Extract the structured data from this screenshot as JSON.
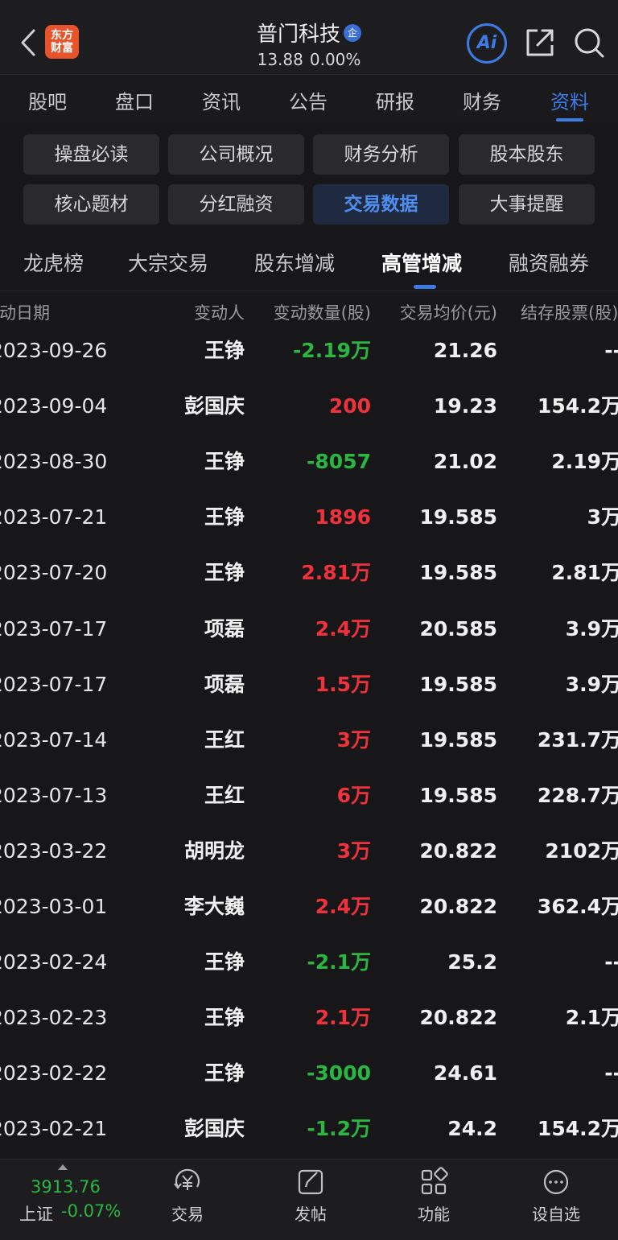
{
  "header": {
    "logo_line1": "东方",
    "logo_line2": "财富",
    "stock_name": "普门科技",
    "badge": "企",
    "price": "13.88",
    "change": "0.00%",
    "ai_label": "Ai"
  },
  "main_tabs": [
    "股吧",
    "盘口",
    "资讯",
    "公告",
    "研报",
    "财务",
    "资料"
  ],
  "main_tabs_active": "资料",
  "sub_buttons": [
    "操盘必读",
    "公司概况",
    "财务分析",
    "股本股东",
    "核心题材",
    "分红融资",
    "交易数据",
    "大事提醒"
  ],
  "sub_buttons_active": "交易数据",
  "category_tabs": [
    "龙虎榜",
    "大宗交易",
    "股东增减",
    "高管增减",
    "融资融券"
  ],
  "category_tabs_active": "高管增减",
  "table": {
    "headers": [
      "变动日期",
      "变动人",
      "变动数量(股)",
      "交易均价(元)",
      "结存股票(股)"
    ],
    "rows": [
      {
        "date": "2023-09-26",
        "person": "王铮",
        "qty": "-2.19万",
        "price": "21.26",
        "hold": "--"
      },
      {
        "date": "2023-09-04",
        "person": "彭国庆",
        "qty": "200",
        "price": "19.23",
        "hold": "154.2万"
      },
      {
        "date": "2023-08-30",
        "person": "王铮",
        "qty": "-8057",
        "price": "21.02",
        "hold": "2.19万"
      },
      {
        "date": "2023-07-21",
        "person": "王铮",
        "qty": "1896",
        "price": "19.585",
        "hold": "3万"
      },
      {
        "date": "2023-07-20",
        "person": "王铮",
        "qty": "2.81万",
        "price": "19.585",
        "hold": "2.81万"
      },
      {
        "date": "2023-07-17",
        "person": "项磊",
        "qty": "2.4万",
        "price": "20.585",
        "hold": "3.9万"
      },
      {
        "date": "2023-07-17",
        "person": "项磊",
        "qty": "1.5万",
        "price": "19.585",
        "hold": "3.9万"
      },
      {
        "date": "2023-07-14",
        "person": "王红",
        "qty": "3万",
        "price": "19.585",
        "hold": "231.7万"
      },
      {
        "date": "2023-07-13",
        "person": "王红",
        "qty": "6万",
        "price": "19.585",
        "hold": "228.7万"
      },
      {
        "date": "2023-03-22",
        "person": "胡明龙",
        "qty": "3万",
        "price": "20.822",
        "hold": "2102万"
      },
      {
        "date": "2023-03-01",
        "person": "李大巍",
        "qty": "2.4万",
        "price": "20.822",
        "hold": "362.4万"
      },
      {
        "date": "2023-02-24",
        "person": "王铮",
        "qty": "-2.1万",
        "price": "25.2",
        "hold": "--"
      },
      {
        "date": "2023-02-23",
        "person": "王铮",
        "qty": "2.1万",
        "price": "20.822",
        "hold": "2.1万"
      },
      {
        "date": "2023-02-22",
        "person": "王铮",
        "qty": "-3000",
        "price": "24.61",
        "hold": "--"
      },
      {
        "date": "2023-02-21",
        "person": "彭国庆",
        "qty": "-1.2万",
        "price": "24.2",
        "hold": "154.2万"
      }
    ]
  },
  "bottom_bar": {
    "index_value": "3913.76",
    "index_name": "上证",
    "index_change": "-0.07%",
    "nav": [
      {
        "label": "交易",
        "icon": "yuan-trade-icon"
      },
      {
        "label": "发帖",
        "icon": "compose-icon"
      },
      {
        "label": "功能",
        "icon": "grid-icon"
      },
      {
        "label": "设自选",
        "icon": "more-icon"
      }
    ]
  },
  "colors": {
    "accent": "#3d7be6",
    "up": "#f0323c",
    "down": "#2ab640",
    "background": "#17171a"
  }
}
